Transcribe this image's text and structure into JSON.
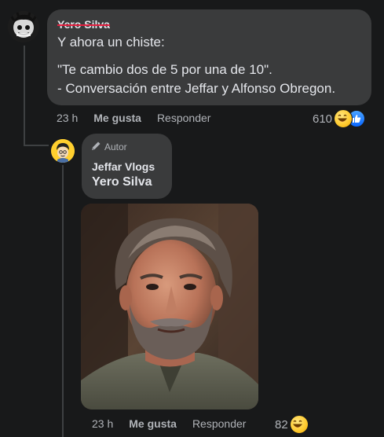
{
  "comment1": {
    "author": "Yero Silva",
    "text_line1": "Y ahora un chiste:",
    "text_line2": "\"Te cambio dos de 5 por una de 10\".",
    "text_line3": "- Conversación entre Jeffar y Alfonso Obregon.",
    "time": "23 h",
    "like_label": "Me gusta",
    "reply_label": "Responder",
    "reaction_count": "610",
    "reaction_icons": [
      "laugh-emoji",
      "like-thumb"
    ]
  },
  "reply1": {
    "badge_label": "Autor",
    "badge_icon": "pencil-icon",
    "author": "Jeffar Vlogs",
    "mention": "Yero Silva",
    "image_alt": "man-with-beard-photo",
    "time": "23 h",
    "like_label": "Me gusta",
    "reply_label": "Responder",
    "reaction_count": "82",
    "reaction_icons": [
      "laugh-emoji"
    ]
  },
  "colors": {
    "background": "#18191a",
    "bubble": "#3a3b3c",
    "secondary_text": "#b0b3b8",
    "strike": "#e41e3f",
    "like_blue": "#0866ff"
  }
}
